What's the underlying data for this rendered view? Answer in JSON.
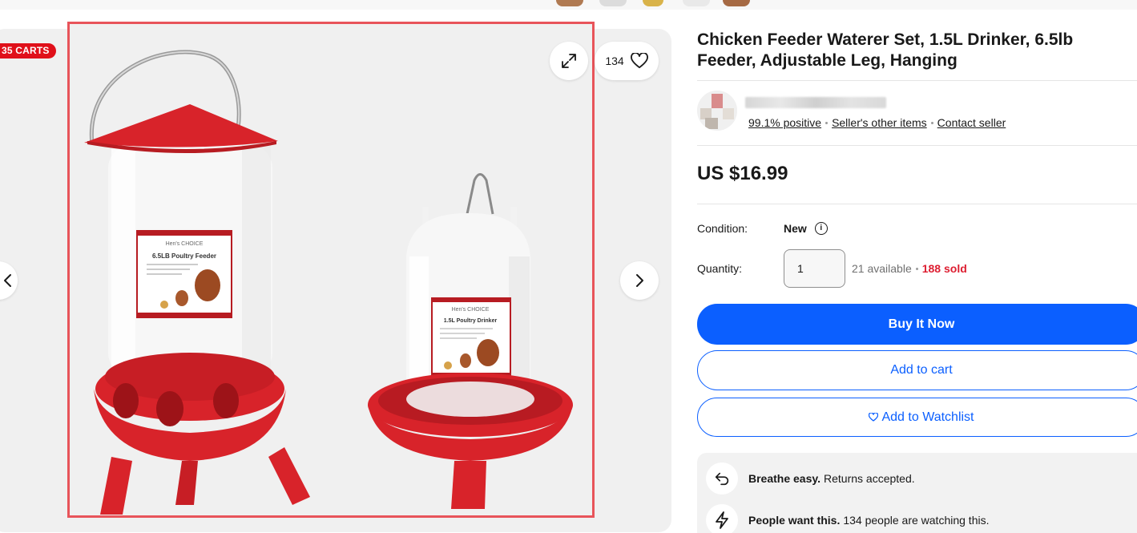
{
  "gallery": {
    "carts_badge": "35 CARTS",
    "watch_count": "134",
    "product_image": {
      "feeder_label_brand": "Hen's CHOICE",
      "feeder_label_title": "6.5LB Poultry Feeder",
      "drinker_label_brand": "Hen's CHOICE",
      "drinker_label_title": "1.5L Poultry Drinker"
    }
  },
  "listing": {
    "title": "Chicken Feeder Waterer Set, 1.5L Drinker, 6.5lb Feeder, Adjustable Leg, Hanging",
    "price": "US $16.99"
  },
  "seller": {
    "feedback": "99.1% positive",
    "other_items": "Seller's other items",
    "contact": "Contact seller"
  },
  "details": {
    "condition_label": "Condition:",
    "condition_value": "New",
    "quantity_label": "Quantity:",
    "quantity_value": "1",
    "available": "21 available",
    "sold": "188 sold"
  },
  "actions": {
    "buy_now": "Buy It Now",
    "add_to_cart": "Add to cart",
    "add_to_watchlist": "Add to Watchlist"
  },
  "promos": [
    {
      "bold": "Breathe easy.",
      "text": "Returns accepted.",
      "icon": "return-arrow-icon"
    },
    {
      "bold": "People want this.",
      "text": "134 people are watching this.",
      "icon": "lightning-icon"
    }
  ],
  "colors": {
    "accent_blue": "#0b5fff",
    "sold_red": "#dd1e31",
    "badge_red": "#e0101a",
    "highlight_border": "#e8545a"
  }
}
